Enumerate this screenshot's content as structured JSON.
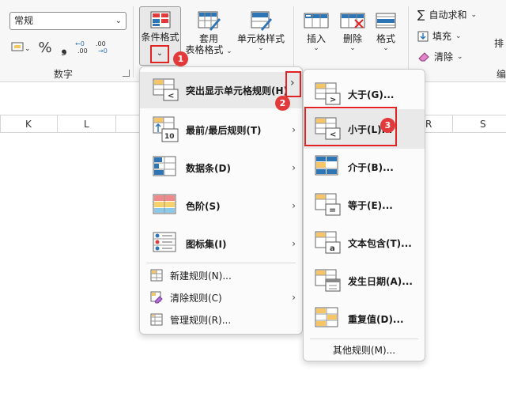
{
  "number_group": {
    "format_value": "常规",
    "percent_symbol": "%",
    "comma_symbol": "❟",
    "label": "数字"
  },
  "styles_group": {
    "conditional_format": "条件格式",
    "table_format_line1": "套用",
    "table_format_line2": "表格格式",
    "cell_styles": "单元格样式"
  },
  "cells_group": {
    "insert": "插入",
    "delete": "删除",
    "format": "格式"
  },
  "editing_group": {
    "autosum": "自动求和",
    "fill": "填充",
    "clear": "清除",
    "sort_partial": "排",
    "label_partial": "编"
  },
  "columns": [
    "K",
    "L",
    "R",
    "S"
  ],
  "cf_menu": {
    "highlight": "突出显示单元格规则(H)",
    "topbottom": "最前/最后规则(T)",
    "databars": "数据条(D)",
    "colorscales": "色阶(S)",
    "iconsets": "图标集(I)",
    "new_rule": "新建规则(N)...",
    "clear_rules": "清除规则(C)",
    "manage_rules": "管理规则(R)..."
  },
  "highlight_submenu": {
    "greater": "大于(G)...",
    "less": "小于(L)...",
    "between": "介于(B)...",
    "equal": "等于(E)...",
    "text_contains": "文本包含(T)...",
    "date_occurring": "发生日期(A)...",
    "duplicate": "重复值(D)...",
    "more_rules": "其他规则(M)..."
  },
  "badges": [
    "1",
    "2",
    "3"
  ],
  "colors": {
    "accent_red": "#e02424",
    "badge_red": "#e23a3a",
    "icon_blue": "#2e75b6",
    "icon_yellow": "#f5c566"
  }
}
